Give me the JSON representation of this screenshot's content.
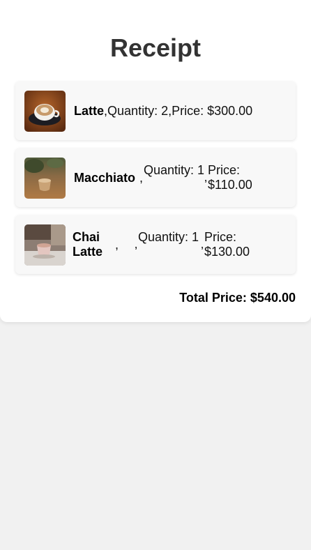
{
  "receipt": {
    "title": "Receipt",
    "items": [
      {
        "name": "Latte",
        "quantity_text": "Quantity: 2",
        "price_text": "Price: $300.00",
        "image": "latte-cup-image"
      },
      {
        "name": "Macchiato",
        "quantity_text": "Quantity: 1",
        "price_text": "Price: $110.00",
        "image": "macchiato-cup-image"
      },
      {
        "name": "Chai Latte",
        "quantity_text": "Quantity: 1",
        "price_text": "Price: $130.00",
        "image": "chai-latte-cup-image"
      }
    ],
    "separator": ",",
    "total_text": "Total Price: $540.00"
  },
  "colors": {
    "page_background": "#f1f1f1",
    "card_background": "#ffffff",
    "item_background": "#f8f8f8",
    "title_color": "#333333"
  }
}
